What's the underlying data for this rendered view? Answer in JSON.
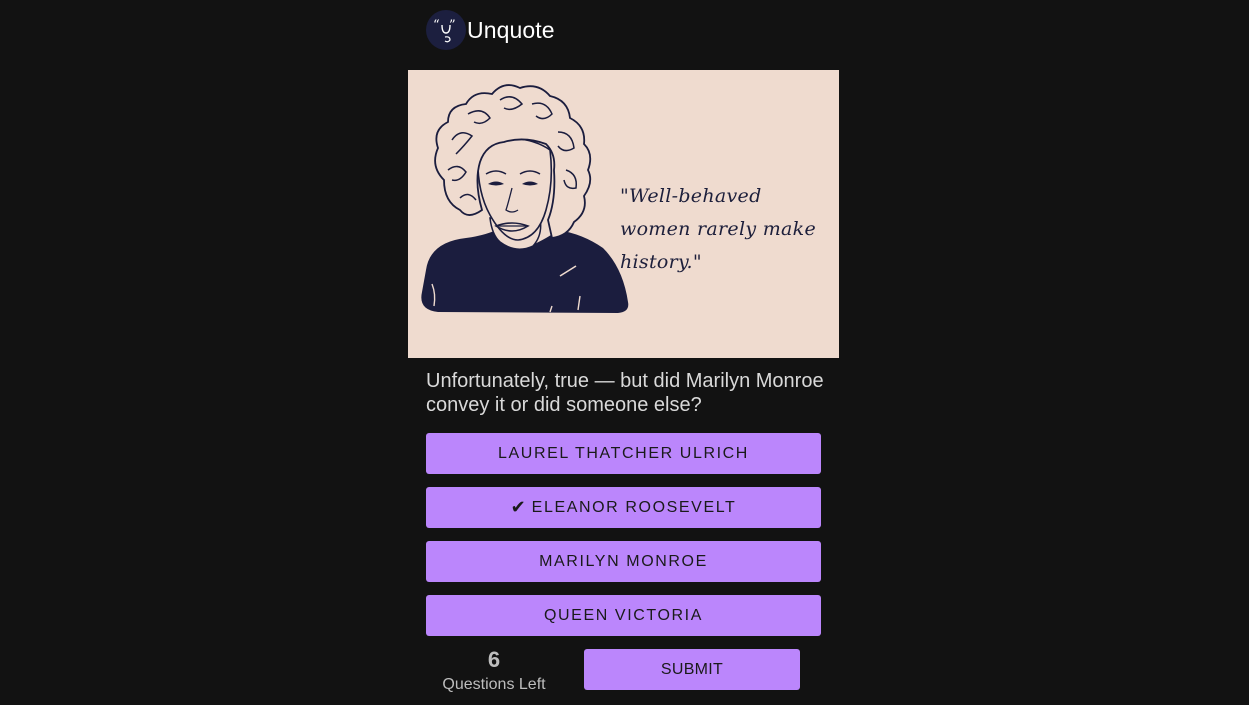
{
  "app": {
    "title": "Unquote",
    "logo_icon": "quote-face-logo-icon"
  },
  "hero": {
    "quote": "\"Well-behaved women rarely make history.\"",
    "illustration": "woman-portrait-sketch"
  },
  "question": {
    "text": "Unfortunately, true — but did Marilyn Monroe convey it or did someone else?"
  },
  "options": [
    {
      "label": "LAUREL THATCHER ULRICH",
      "selected": false
    },
    {
      "label": "ELEANOR ROOSEVELT",
      "selected": true,
      "check": "✔"
    },
    {
      "label": "MARILYN MONROE",
      "selected": false
    },
    {
      "label": "QUEEN VICTORIA",
      "selected": false
    }
  ],
  "progress": {
    "count": "6",
    "label": "Questions Left"
  },
  "submit": {
    "label": "SUBMIT"
  },
  "colors": {
    "background": "#121212",
    "accent": "#bb86fc",
    "hero_bg": "#efdbcf",
    "ink": "#1c1f3f"
  }
}
